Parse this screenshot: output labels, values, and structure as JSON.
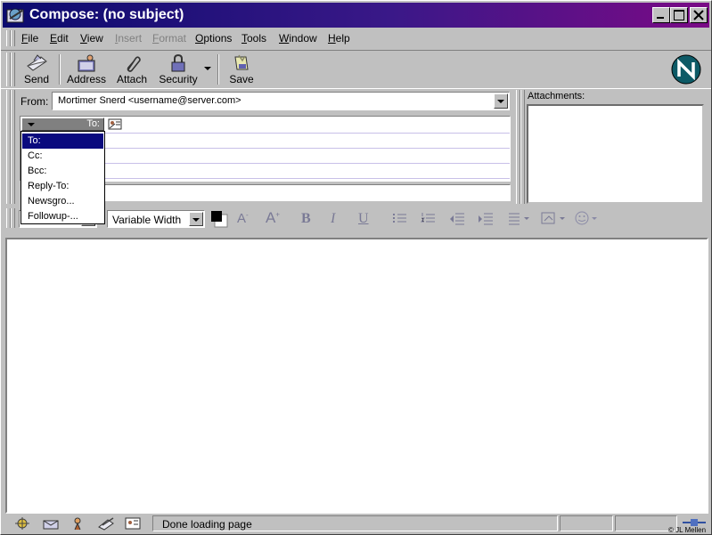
{
  "window": {
    "title": "Compose: (no subject)"
  },
  "menu": {
    "items": [
      {
        "label": "File",
        "ul": "F",
        "rest": "ile",
        "enabled": true
      },
      {
        "label": "Edit",
        "ul": "E",
        "rest": "dit",
        "enabled": true
      },
      {
        "label": "View",
        "ul": "V",
        "rest": "iew",
        "enabled": true
      },
      {
        "label": "Insert",
        "ul": "I",
        "rest": "nsert",
        "enabled": false
      },
      {
        "label": "Format",
        "ul": "F",
        "rest": "ormat",
        "enabled": false
      },
      {
        "label": "Options",
        "ul": "O",
        "rest": "ptions",
        "enabled": true
      },
      {
        "label": "Tools",
        "ul": "T",
        "rest": "ools",
        "enabled": true
      },
      {
        "label": "Window",
        "ul": "W",
        "rest": "indow",
        "enabled": true
      },
      {
        "label": "Help",
        "ul": "H",
        "rest": "elp",
        "enabled": true
      }
    ]
  },
  "toolbar": {
    "send": "Send",
    "address": "Address",
    "attach": "Attach",
    "security": "Security",
    "save": "Save"
  },
  "header": {
    "from_label": "From:",
    "from_value": "Mortimer Snerd <username@server.com>",
    "to_selector": "To:",
    "attachments_label": "Attachments:"
  },
  "address_popup": {
    "items": [
      "To:",
      "Cc:",
      "Bcc:",
      "Reply-To:",
      "Newsgro...",
      "Followup-..."
    ],
    "selected_index": 0
  },
  "format_toolbar": {
    "font": "Variable Width",
    "bold": "B",
    "italic": "I",
    "underline": "U"
  },
  "status": {
    "text": "Done loading page",
    "copyright": "© JL Mellen"
  },
  "colors": {
    "title_start": "#0b0b6e",
    "title_end": "#7a0a86",
    "selection": "#0a0a7e",
    "chrome": "#c0c0c0"
  }
}
